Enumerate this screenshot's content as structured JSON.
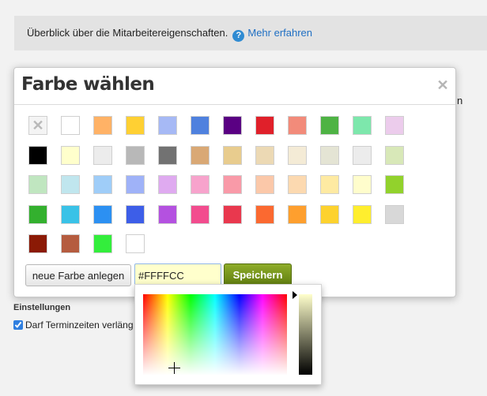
{
  "infobar": {
    "text": "Überblick über die Mitarbeitereigenschaften.",
    "help_icon": "?",
    "link": "Mehr erfahren"
  },
  "background": {
    "right_text": "n",
    "settings_title": "Einstellungen",
    "settings_checkbox_label": "Darf Terminzeiten verläng"
  },
  "dialog": {
    "title": "Farbe wählen",
    "close_icon": "✕",
    "swatches": [
      [
        "none",
        "#ffffff",
        "#ffb266",
        "#ffd033",
        "#a6b9f5",
        "#4f81de",
        "#5a0083",
        "#e0202a",
        "#f28b7a",
        "#4eb344",
        "#7de7ac",
        "#ecccec"
      ],
      [
        "#000000",
        "#ffffcc",
        "#ececec",
        "#b8b8b8",
        "#727272",
        "#d9a875",
        "#e8cc8e",
        "#ecd9b4",
        "#f4ebd6",
        "#e4e4d4",
        "#ececec",
        "#d8e8b8"
      ],
      [
        "#c0e6c0",
        "#c0e6ee",
        "#9fcdf8",
        "#9fb2f8",
        "#dfaaf0",
        "#f7a3cc",
        "#f99aa8",
        "#fbc8a9",
        "#fcd9b0",
        "#feeaa2",
        "#fffdcc",
        "#92d22c"
      ],
      [
        "#33b02e",
        "#39c2e7",
        "#2c90f2",
        "#3d5ee8",
        "#b451e0",
        "#f24c8e",
        "#e9384e",
        "#fb6930",
        "#fe9f2e",
        "#fdd22e",
        "#ffee2e",
        "#d8d8d8"
      ],
      [
        "#8b1a05",
        "#b55c3f",
        "#33ee3c",
        "#ffffff"
      ]
    ],
    "new_color_label": "neue Farbe anlegen",
    "hex_value": "#FFFFCC",
    "save_label": "Speichern",
    "selected_color": "#ffffcc"
  }
}
